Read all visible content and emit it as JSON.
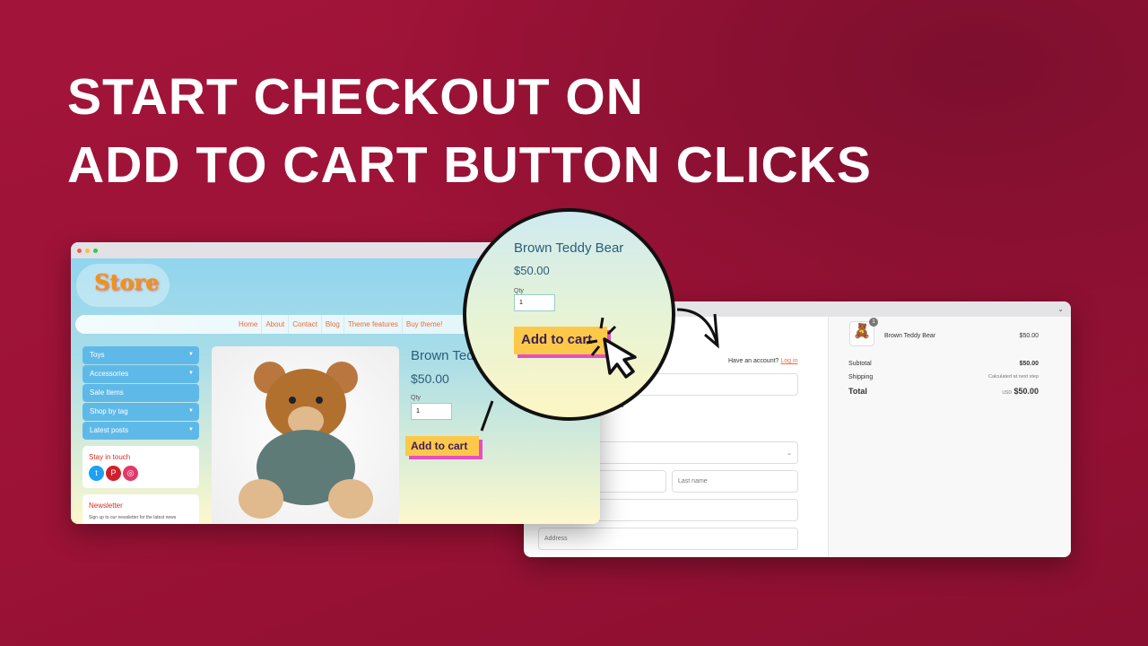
{
  "headline": {
    "line1": "START CHECKOUT ON",
    "line2": "ADD TO CART BUTTON CLICKS"
  },
  "store": {
    "logo": "Store",
    "nav": [
      "Home",
      "About",
      "Contact",
      "Blog",
      "Theme features",
      "Buy theme!"
    ],
    "sidebar": [
      {
        "label": "Toys",
        "dropdown": true
      },
      {
        "label": "Accessories",
        "dropdown": true
      },
      {
        "label": "Sale Items",
        "dropdown": false
      },
      {
        "label": "Shop by tag",
        "dropdown": true
      },
      {
        "label": "Latest posts",
        "dropdown": true
      }
    ],
    "stay_in_touch": "Stay in touch",
    "social": [
      "twitter-icon",
      "pinterest-icon",
      "instagram-icon"
    ],
    "newsletter_title": "Newsletter",
    "newsletter_text": "Sign up to our newsletter for the latest news",
    "product": {
      "title": "Brown Teddy Bear",
      "title_visible": "Brown Teddy",
      "price": "$50.00",
      "qty_label": "Qty",
      "qty": "1",
      "add_to_cart": "Add to cart"
    }
  },
  "checkout": {
    "have_account": "Have an account?",
    "login": "Log in",
    "offers_partial": "ffers",
    "section_partial": "s",
    "last_name": "Last name",
    "address": "Address",
    "summary": {
      "item": "Brown Teddy Bear",
      "item_price": "$50.00",
      "badge": "1",
      "subtotal_label": "Subtotal",
      "subtotal": "$50.00",
      "shipping_label": "Shipping",
      "shipping": "Calculated at next step",
      "total_label": "Total",
      "currency": "USD",
      "total": "$50.00"
    }
  },
  "colors": {
    "background": "#9c1236",
    "button": "#fcc84a",
    "button_shadow": "#e64fc1",
    "link": "#f2693a"
  }
}
